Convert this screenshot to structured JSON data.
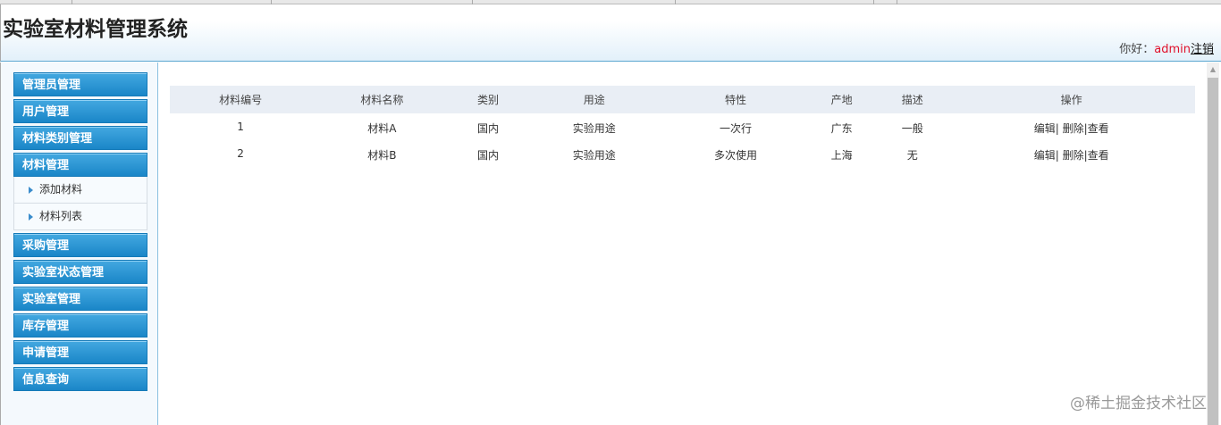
{
  "header": {
    "title": "实验室材料管理系统",
    "greeting": "你好：",
    "username": "admin",
    "logout": "注销"
  },
  "sidebar": {
    "items": [
      {
        "label": "管理员管理"
      },
      {
        "label": "用户管理"
      },
      {
        "label": "材料类别管理"
      },
      {
        "label": "材料管理",
        "children": [
          {
            "label": "添加材料"
          },
          {
            "label": "材料列表"
          }
        ]
      },
      {
        "label": "采购管理"
      },
      {
        "label": "实验室状态管理"
      },
      {
        "label": "实验室管理"
      },
      {
        "label": "库存管理"
      },
      {
        "label": "申请管理"
      },
      {
        "label": "信息查询"
      }
    ]
  },
  "table": {
    "headers": [
      "材料编号",
      "材料名称",
      "类别",
      "用途",
      "特性",
      "产地",
      "描述",
      "操作"
    ],
    "rows": [
      [
        "1",
        "材料A",
        "国内",
        "实验用途",
        "一次行",
        "广东",
        "一般"
      ],
      [
        "2",
        "材料B",
        "国内",
        "实验用途",
        "多次使用",
        "上海",
        "无"
      ]
    ],
    "actions": {
      "edit": "编辑|",
      "delete": "删除|",
      "view": "查看"
    }
  },
  "watermark": "@稀土掘金技术社区"
}
